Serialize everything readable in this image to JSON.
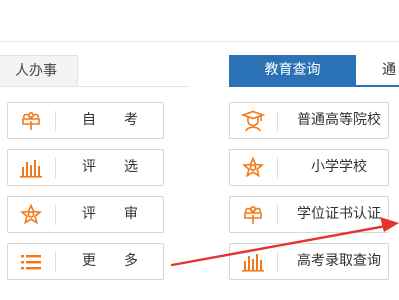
{
  "tabs": {
    "left_tab": "人办事",
    "active_tab": "教育查询",
    "next_tab": "通"
  },
  "left_tiles": [
    {
      "label": "自考",
      "icon": "sprout-icon"
    },
    {
      "label": "评选",
      "icon": "bar-chart-icon"
    },
    {
      "label": "评审",
      "icon": "star-badge-icon"
    },
    {
      "label": "更多",
      "icon": "list-icon"
    }
  ],
  "right_tiles": [
    {
      "label": "普通高等院校",
      "icon": "graduate-icon"
    },
    {
      "label": "小学学校",
      "icon": "star-badge-icon"
    },
    {
      "label": "学位证书认证",
      "icon": "sprout-icon"
    },
    {
      "label": "高考录取查询",
      "icon": "bar-chart-icon"
    }
  ],
  "colors": {
    "accent": "#2a72b5",
    "icon": "#f07a1a",
    "annotation_arrow": "#e3342f"
  }
}
